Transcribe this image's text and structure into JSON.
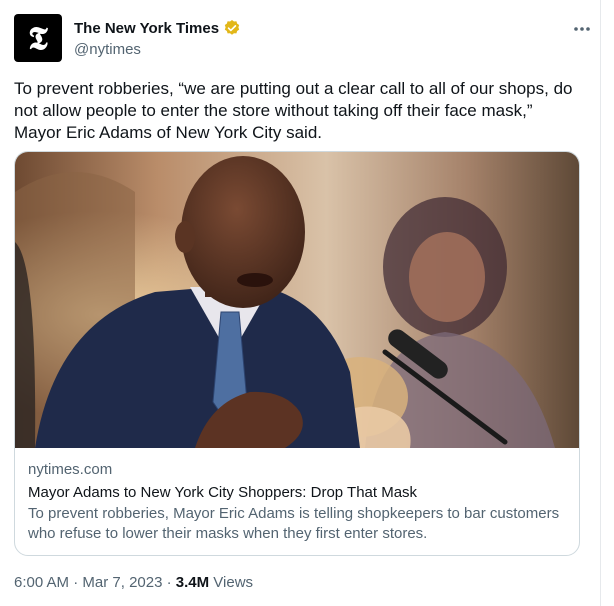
{
  "author": {
    "display_name": "The New York Times",
    "handle": "@nytimes",
    "avatar_glyph": "𝕿",
    "verified_badge_color": "#e2b719"
  },
  "menu": {
    "icon": "more-horizontal-icon"
  },
  "tweet": {
    "text": "To prevent robberies, “we are putting out a clear call to all of our shops, do not allow people to enter the store without taking off their face mask,” Mayor Eric Adams of New York City said."
  },
  "card": {
    "domain": "nytimes.com",
    "title": "Mayor Adams to New York City Shoppers: Drop That Mask",
    "description": "To prevent robberies, Mayor Eric Adams is telling shopkeepers to bar customers who refuse to lower their masks when they first enter stores."
  },
  "footer": {
    "time": "6:00 AM",
    "separator": " · ",
    "date": "Mar 7, 2023",
    "views_count": "3.4M",
    "views_label": " Views"
  },
  "colors": {
    "text_primary": "#0f1419",
    "text_secondary": "#536471",
    "border": "#cfd9de"
  }
}
